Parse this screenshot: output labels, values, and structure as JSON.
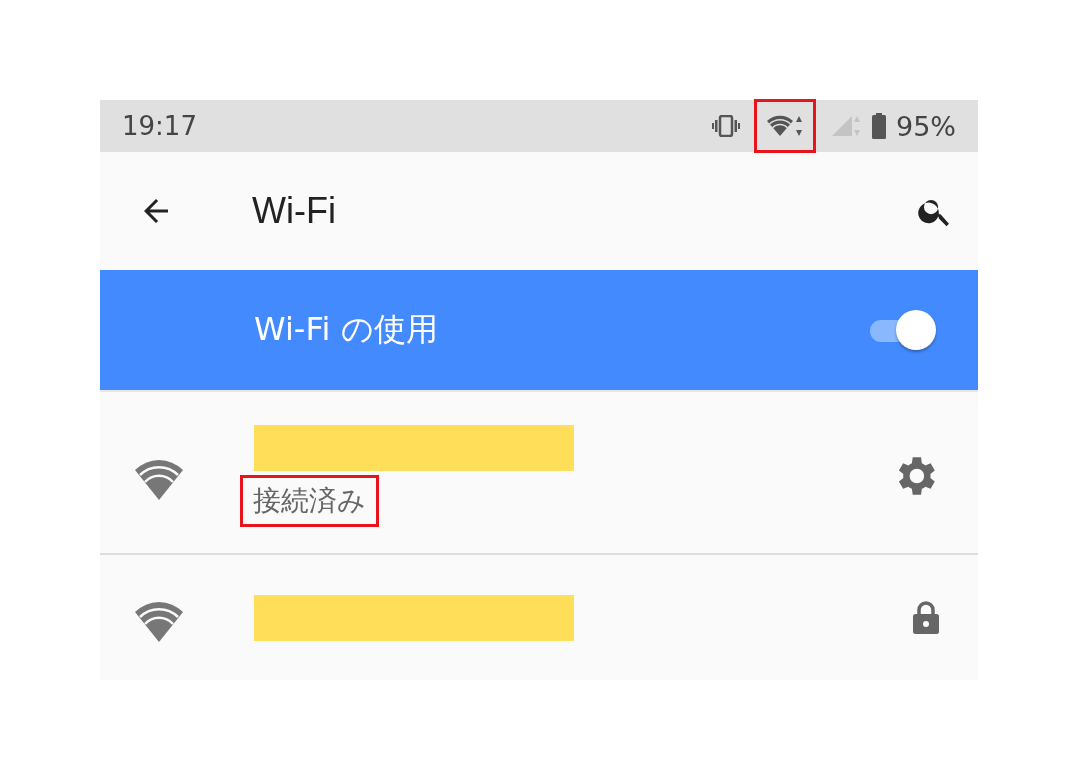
{
  "status_bar": {
    "time": "19:17",
    "wifi_highlighted": true,
    "battery": "95%"
  },
  "toolbar": {
    "title": "Wi-Fi"
  },
  "master_switch": {
    "label": "Wi-Fi の使用",
    "on": true
  },
  "networks": [
    {
      "name_redacted": true,
      "status": "接続済み",
      "status_highlighted": true,
      "kind": "settings"
    },
    {
      "name_redacted": true,
      "kind": "lock"
    }
  ]
}
